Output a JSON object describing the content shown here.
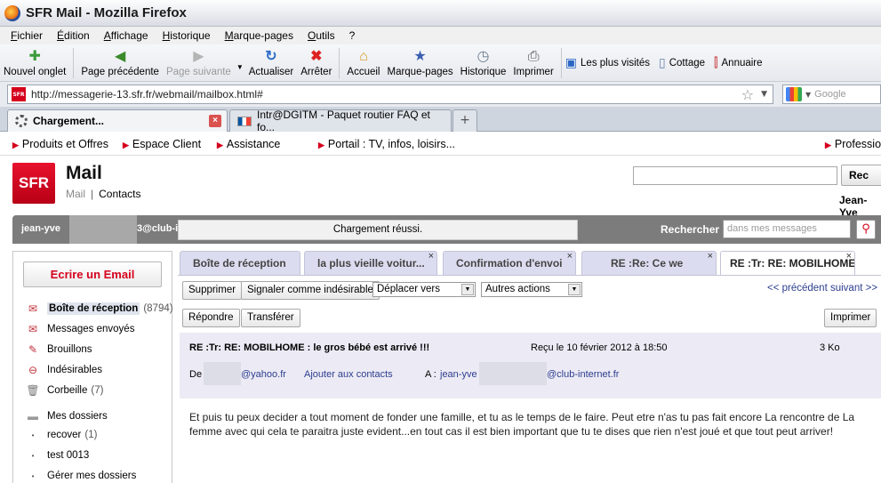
{
  "window": {
    "title": "SFR Mail - Mozilla Firefox"
  },
  "menu": [
    "Fichier",
    "Édition",
    "Affichage",
    "Historique",
    "Marque-pages",
    "Outils",
    "?"
  ],
  "toolbar": {
    "new_tab": "Nouvel onglet",
    "back": "Page précédente",
    "forward": "Page suivante",
    "reload": "Actualiser",
    "stop": "Arrêter",
    "home": "Accueil",
    "bookmarks": "Marque-pages",
    "history": "Historique",
    "print": "Imprimer",
    "bm_most_visited": "Les plus visités",
    "bm_cottage": "Cottage",
    "bm_annuaire": "Annuaire"
  },
  "address_bar": {
    "url": "http://messagerie-13.sfr.fr/webmail/mailbox.html#",
    "search_placeholder": "Google"
  },
  "browser_tabs": [
    {
      "label": "Chargement..."
    },
    {
      "label": "Intr@DGITM - Paquet routier FAQ et fo..."
    }
  ],
  "topnav": [
    "Produits et Offres",
    "Espace Client",
    "Assistance",
    "Portail : TV, infos, loisirs...",
    "Profession"
  ],
  "header": {
    "logo_text": "SFR",
    "title": "Mail",
    "nav_mail": "Mail",
    "nav_sep": "|",
    "nav_contacts": "Contacts",
    "search_button": "Rec",
    "username": "Jean-Yve"
  },
  "status_bar": {
    "account_prefix": "jean-yve",
    "account_suffix": "3@club-i",
    "message": "Chargement réussi.",
    "search_label": "Rechercher",
    "search_placeholder": "dans mes messages"
  },
  "sidebar": {
    "compose": "Ecrire un Email",
    "folders": [
      {
        "label": "Boîte de réception",
        "count": "(8794)"
      },
      {
        "label": "Messages envoyés",
        "count": ""
      },
      {
        "label": "Brouillons",
        "count": ""
      },
      {
        "label": "Indésirables",
        "count": ""
      },
      {
        "label": "Corbeille",
        "count": "(7)"
      },
      {
        "label": "Mes dossiers",
        "count": ""
      },
      {
        "label": "recover",
        "count": "(1)"
      },
      {
        "label": "test 0013",
        "count": ""
      },
      {
        "label": "Gérer mes dossiers",
        "count": ""
      }
    ]
  },
  "mail_tabs": [
    {
      "label": "Boîte de réception"
    },
    {
      "label": "la plus vieille voitur..."
    },
    {
      "label": "Confirmation d'envoi"
    },
    {
      "label": "RE :Re: Ce we"
    },
    {
      "label": "RE :Tr: RE: MOBILHOME"
    }
  ],
  "actions": {
    "delete": "Supprimer",
    "spam": "Signaler comme indésirable",
    "move": "Déplacer vers",
    "other": "Autres actions",
    "pager": "<< précédent suivant >>",
    "reply": "Répondre",
    "forward": "Transférer",
    "print": "Imprimer"
  },
  "message": {
    "subject": "RE :Tr: RE: MOBILHOME : le gros bébé est arrivé !!!",
    "received": "Reçu le 10 février 2012 à 18:50",
    "size": "3 Ko",
    "from_label": "De",
    "from_domain": "@yahoo.fr",
    "add_contact": "Ajouter aux contacts",
    "to_label": "A :",
    "to_prefix": "jean-yve",
    "to_domain": "@club-internet.fr",
    "body": "Et puis tu peux decider a tout moment de fonder une famille, et tu as le temps de le faire. Peut etre n'as tu pas fait encore La rencontre de La femme avec qui cela te paraitra juste evident...en tout cas il est bien important que tu te dises que rien n'est joué et que tout peut arriver!"
  }
}
